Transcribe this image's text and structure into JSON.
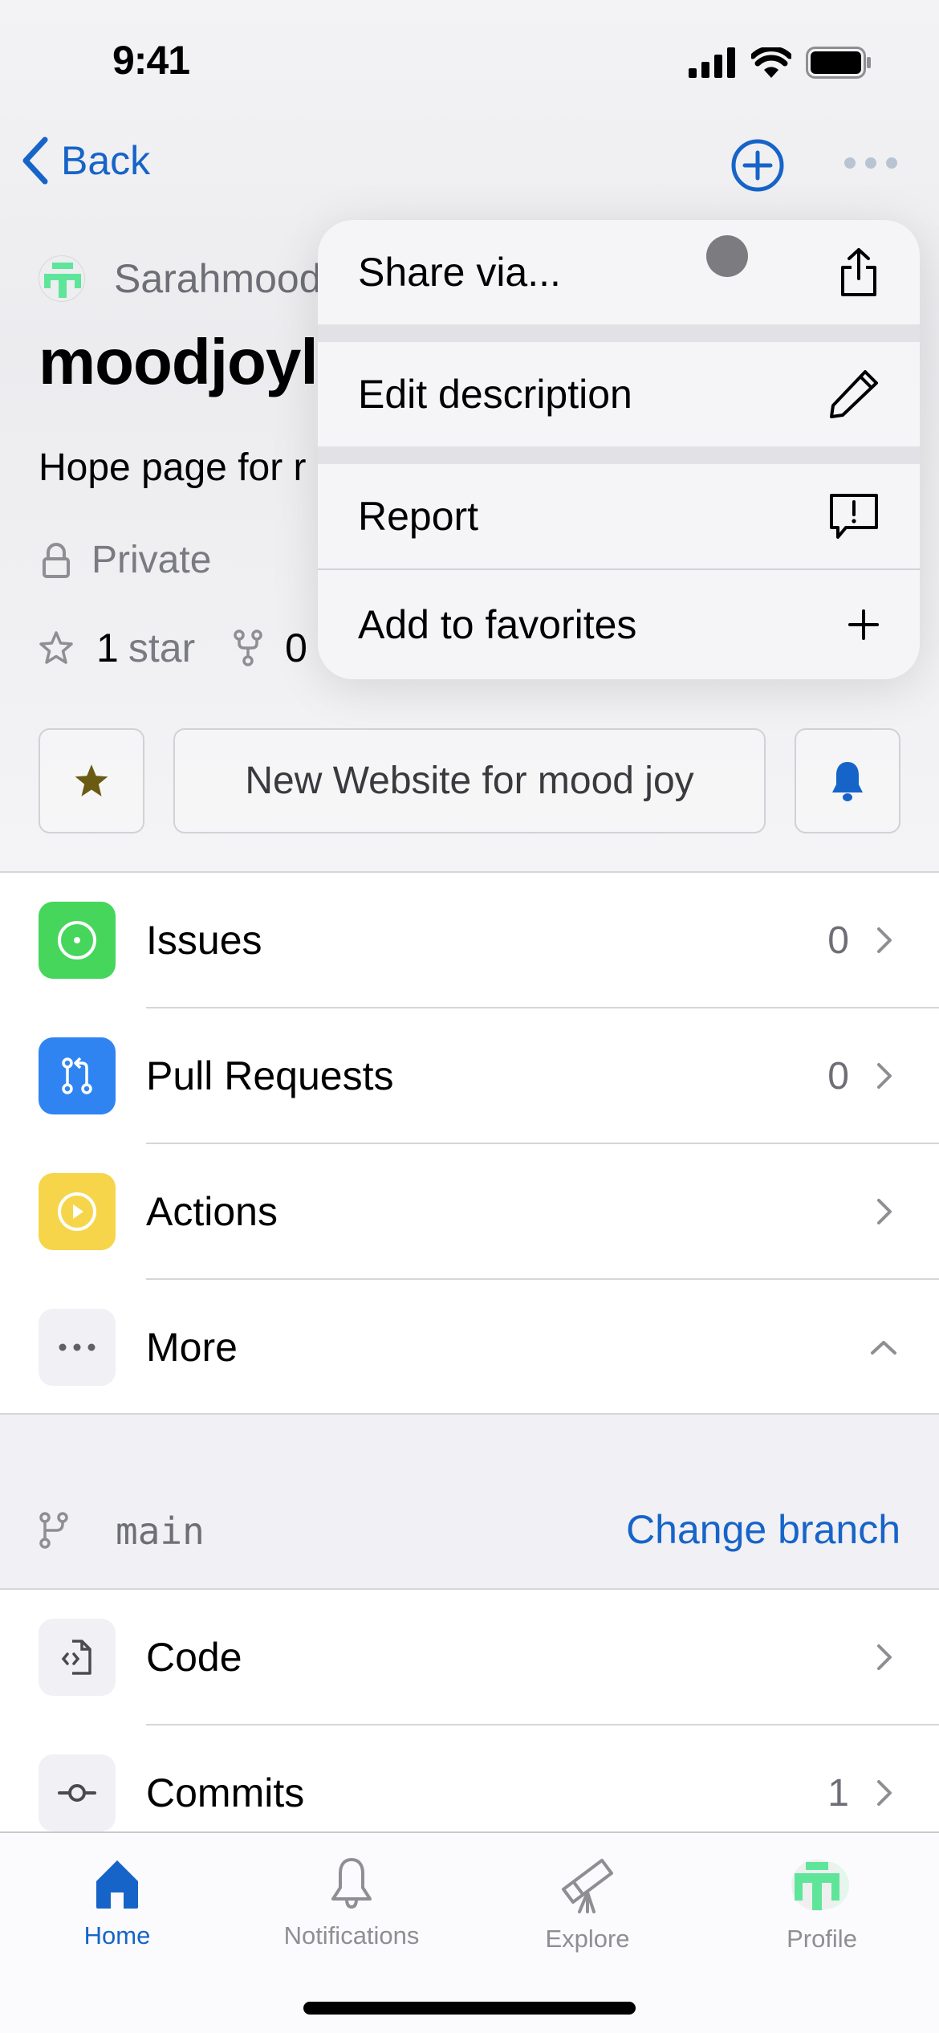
{
  "status_bar": {
    "time": "9:41"
  },
  "nav": {
    "back_label": "Back"
  },
  "repo": {
    "owner": "Sarahmood",
    "name": "moodjoyl",
    "description": "Hope page for r",
    "visibility": "Private",
    "stars_count": "1",
    "stars_label": "star",
    "forks_count": "0"
  },
  "action_buttons": {
    "description_button": "New Website for mood joy"
  },
  "menu": {
    "items": [
      {
        "label": "Share via...",
        "icon": "share-icon"
      },
      {
        "label": "Edit description",
        "icon": "pencil-icon"
      },
      {
        "label": "Report",
        "icon": "report-icon"
      },
      {
        "label": "Add to favorites",
        "icon": "plus-icon"
      }
    ]
  },
  "list": {
    "items": [
      {
        "label": "Issues",
        "count": "0",
        "icon": "issues-icon",
        "color": "#45d65b"
      },
      {
        "label": "Pull Requests",
        "count": "0",
        "icon": "pull-request-icon",
        "color": "#2f84f2"
      },
      {
        "label": "Actions",
        "count": "",
        "icon": "actions-icon",
        "color": "#f6d54a"
      },
      {
        "label": "More",
        "count": "",
        "icon": "more-icon",
        "color": "#f0f0f5"
      }
    ]
  },
  "branch": {
    "name": "main",
    "change_label": "Change branch"
  },
  "code_list": {
    "items": [
      {
        "label": "Code",
        "count": "",
        "icon": "code-file-icon"
      },
      {
        "label": "Commits",
        "count": "1",
        "icon": "commit-icon"
      }
    ]
  },
  "tab_bar": {
    "tabs": [
      {
        "label": "Home",
        "active": true
      },
      {
        "label": "Notifications",
        "active": false
      },
      {
        "label": "Explore",
        "active": false
      },
      {
        "label": "Profile",
        "active": false
      }
    ]
  },
  "colors": {
    "accent": "#1764c8",
    "star": "#6b5a12",
    "avatar_green": "#5ee59a"
  }
}
